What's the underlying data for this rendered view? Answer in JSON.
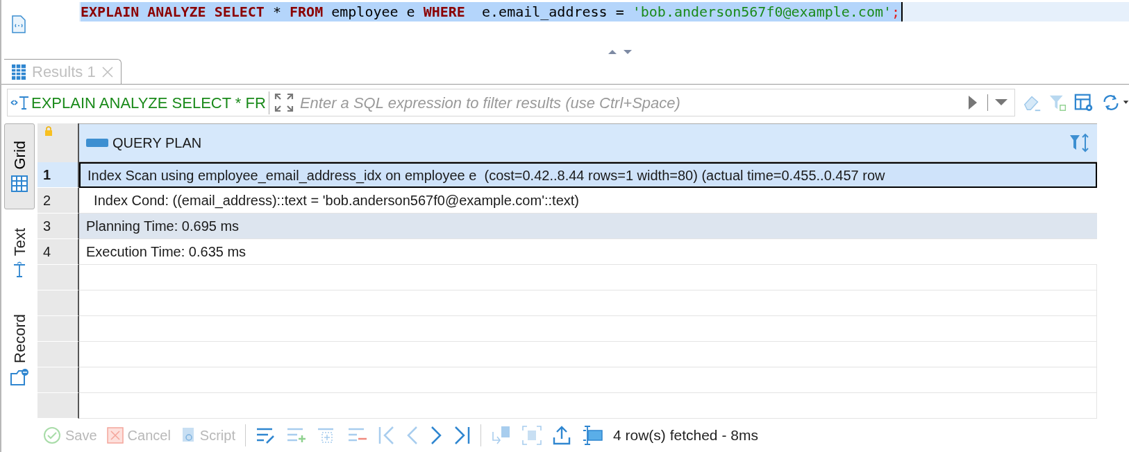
{
  "editor": {
    "tokens": [
      {
        "text": "EXPLAIN ANALYZE SELECT",
        "kind": "keyword"
      },
      {
        "text": " * ",
        "kind": "plain"
      },
      {
        "text": "FROM",
        "kind": "keyword"
      },
      {
        "text": " employee e ",
        "kind": "plain"
      },
      {
        "text": "WHERE",
        "kind": "keyword"
      },
      {
        "text": "  e.email_address = ",
        "kind": "plain"
      },
      {
        "text": "'bob.anderson567f0@example.com'",
        "kind": "string"
      },
      {
        "text": ";",
        "kind": "punct"
      }
    ]
  },
  "tabs": [
    {
      "label": "Results 1",
      "selected": true
    }
  ],
  "filter": {
    "query": "EXPLAIN ANALYZE SELECT * FR",
    "placeholder": "Enter a SQL expression to filter results (use Ctrl+Space)"
  },
  "side_tabs": [
    {
      "label": "Grid",
      "selected": true
    },
    {
      "label": "Text",
      "selected": false
    },
    {
      "label": "Record",
      "selected": false
    }
  ],
  "table": {
    "columns": [
      "QUERY PLAN"
    ],
    "rows": [
      {
        "number": "1",
        "text": "Index Scan using employee_email_address_idx on employee e  (cost=0.42..8.44 rows=1 width=80) (actual time=0.455..0.457 row",
        "selected": true,
        "hovered": false
      },
      {
        "number": "2",
        "text": "  Index Cond: ((email_address)::text = 'bob.anderson567f0@example.com'::text)",
        "selected": false,
        "hovered": false
      },
      {
        "number": "3",
        "text": "Planning Time: 0.695 ms",
        "selected": false,
        "hovered": true
      },
      {
        "number": "4",
        "text": "Execution Time: 0.635 ms",
        "selected": false,
        "hovered": false
      }
    ]
  },
  "bottom_bar": {
    "buttons": [
      {
        "label": "Save",
        "disabled": true
      },
      {
        "label": "Cancel",
        "disabled": true
      },
      {
        "label": "Script",
        "disabled": true
      }
    ],
    "status": "4 row(s) fetched - 8ms"
  }
}
